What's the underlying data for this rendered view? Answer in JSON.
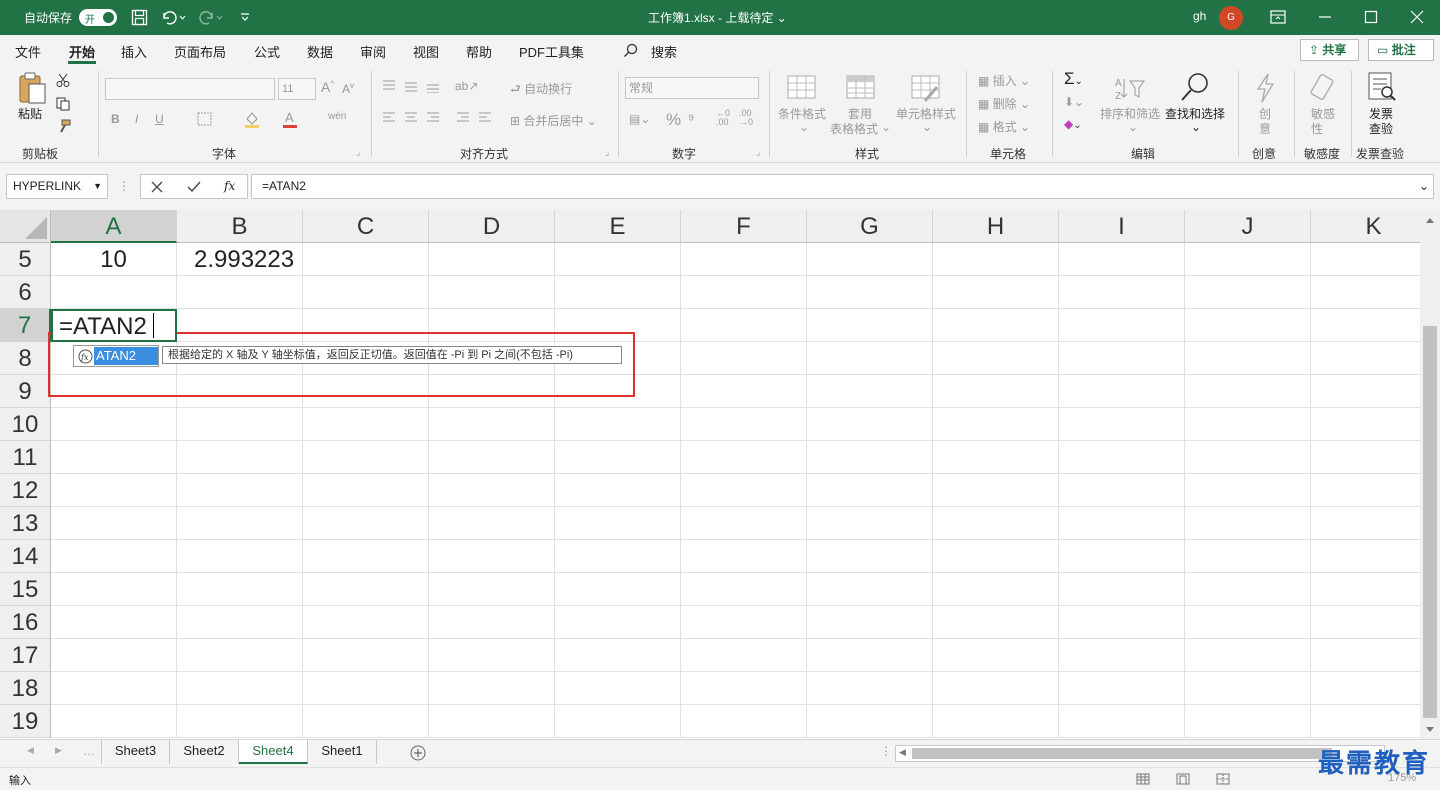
{
  "titlebar": {
    "autosave_label": "自动保存",
    "autosave_state": "开",
    "file_title": "工作簿1.xlsx - 上载待定 ⌄",
    "user": "gh",
    "avatar_letter": "G"
  },
  "menu": {
    "items": [
      "文件",
      "开始",
      "插入",
      "页面布局",
      "公式",
      "数据",
      "审阅",
      "视图",
      "帮助",
      "PDF工具集"
    ],
    "search": "搜索",
    "share": "共享",
    "comment": "批注"
  },
  "ribbon": {
    "clipboard": {
      "paste": "粘贴",
      "group": "剪贴板"
    },
    "font": {
      "size": "11",
      "bold": "B",
      "italic": "I",
      "underline": "U",
      "group": "字体"
    },
    "align": {
      "wrap": "自动换行",
      "merge": "合并后居中",
      "group": "对齐方式"
    },
    "number": {
      "format": "常规",
      "group": "数字"
    },
    "styles": {
      "cond": "条件格式",
      "table1": "套用",
      "table2": "表格格式",
      "cell": "单元格样式",
      "group": "样式"
    },
    "cells": {
      "insert": "插入",
      "delete": "删除",
      "format": "格式",
      "group": "单元格"
    },
    "edit": {
      "sort": "排序和筛选",
      "find": "查找和选择",
      "group": "编辑"
    },
    "ideas": {
      "l1": "创",
      "l2": "意",
      "group": "创意"
    },
    "sens": {
      "l1": "敏感",
      "l2": "性",
      "group": "敏感度"
    },
    "invoice": {
      "l1": "发票",
      "l2": "查验",
      "group": "发票查验"
    }
  },
  "formula_bar": {
    "name_box": "HYPERLINK",
    "fx": "fx",
    "formula": "=ATAN2"
  },
  "grid": {
    "columns": [
      "A",
      "B",
      "C",
      "D",
      "E",
      "F",
      "G",
      "H",
      "I",
      "J",
      "K"
    ],
    "rows": [
      "5",
      "6",
      "7",
      "8",
      "9",
      "10",
      "11",
      "12",
      "13",
      "14",
      "15",
      "16",
      "17",
      "18",
      "19"
    ],
    "cells": {
      "A5": "10",
      "B5": "2.993223",
      "A7": "=ATAN2"
    }
  },
  "autocomplete": {
    "item": "ATAN2",
    "tooltip": "根据给定的 X 轴及 Y 轴坐标值，返回反正切值。返回值在 -Pi 到 Pi 之间(不包括 -Pi)"
  },
  "sheets": {
    "tabs": [
      "Sheet3",
      "Sheet2",
      "Sheet4",
      "Sheet1"
    ],
    "active": "Sheet4"
  },
  "status": {
    "mode": "输入",
    "zoom": "175%"
  },
  "watermark": "最需教育"
}
